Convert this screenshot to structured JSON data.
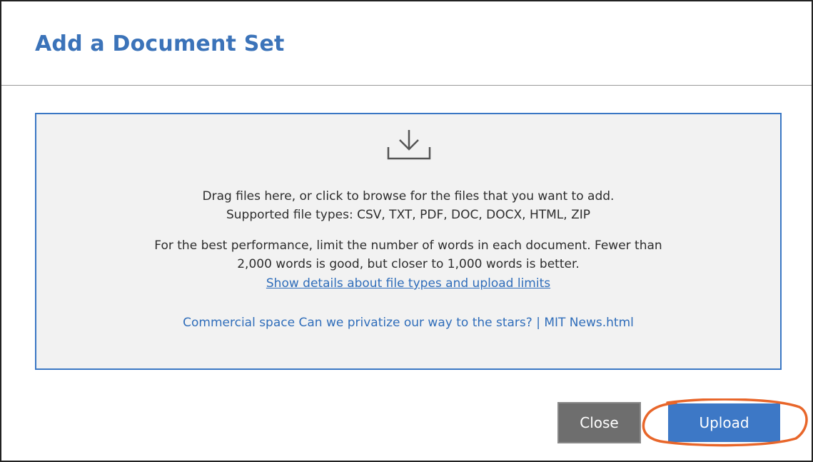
{
  "dialog": {
    "title": "Add a Document Set"
  },
  "dropzone": {
    "icon": "download-icon",
    "line1": "Drag files here, or click to browse for the files that you want to add.",
    "line2": "Supported file types: CSV, TXT, PDF, DOC, DOCX, HTML, ZIP",
    "line3": "For the best performance, limit the number of words in each document. Fewer than",
    "line4": "2,000 words is good, but closer to 1,000 words is better.",
    "details_link": "Show details about file types and upload limits",
    "selected_file": "Commercial space Can we privatize our way to the stars? | MIT News.html"
  },
  "footer": {
    "close_label": "Close",
    "upload_label": "Upload"
  },
  "colors": {
    "accent": "#3b73b9",
    "upload_button": "#3d78c6",
    "close_button": "#6e6e6e",
    "annotation": "#e8662a"
  }
}
